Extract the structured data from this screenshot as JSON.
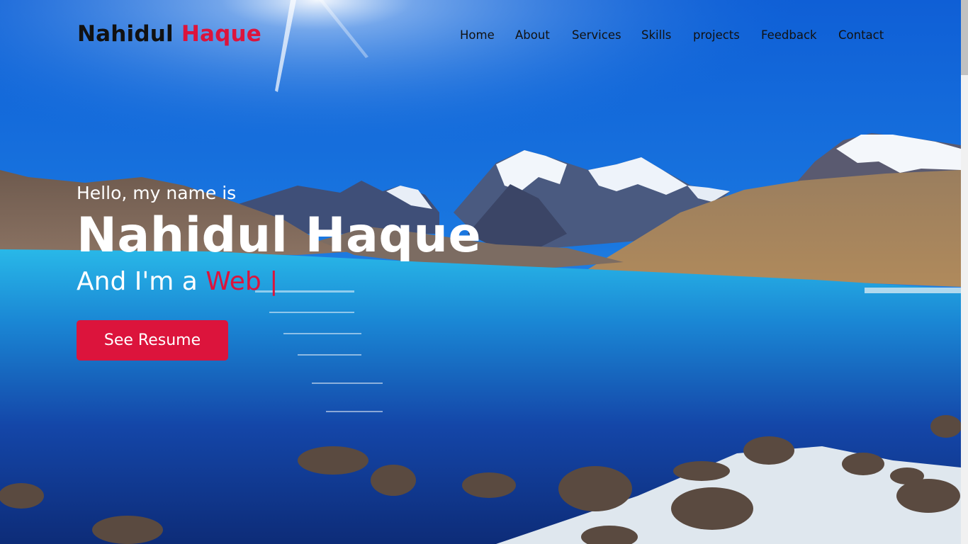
{
  "nav": {
    "logo_first": "Nahidul",
    "logo_second": "Haque",
    "items": [
      {
        "label": "Home"
      },
      {
        "label": "About"
      },
      {
        "label": "Services"
      },
      {
        "label": "Skills"
      },
      {
        "label": "projects"
      },
      {
        "label": "Feedback"
      },
      {
        "label": "Contact"
      }
    ]
  },
  "hero": {
    "greeting": "Hello, my name is",
    "name": "Nahidul Haque",
    "role_prefix": "And I'm a",
    "role_typed": "Web |",
    "button_label": "See Resume",
    "background_image": "mountain-lake-landscape"
  },
  "colors": {
    "accent": "#dc143c",
    "text_dark": "#111111",
    "text_light": "#ffffff"
  }
}
